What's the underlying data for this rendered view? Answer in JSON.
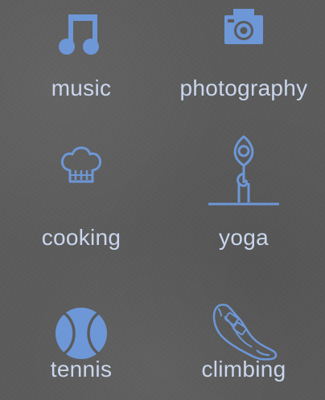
{
  "accent_color": "#6d97d7",
  "label_color": "#c9d6ec",
  "background_color": "#5b5b5b",
  "hobbies": [
    {
      "label": "music",
      "icon": "music-note-icon"
    },
    {
      "label": "photography",
      "icon": "camera-icon"
    },
    {
      "label": "cooking",
      "icon": "chef-hat-icon"
    },
    {
      "label": "yoga",
      "icon": "yoga-pose-icon"
    },
    {
      "label": "tennis",
      "icon": "tennis-ball-icon"
    },
    {
      "label": "climbing",
      "icon": "climbing-shoe-icon"
    }
  ]
}
